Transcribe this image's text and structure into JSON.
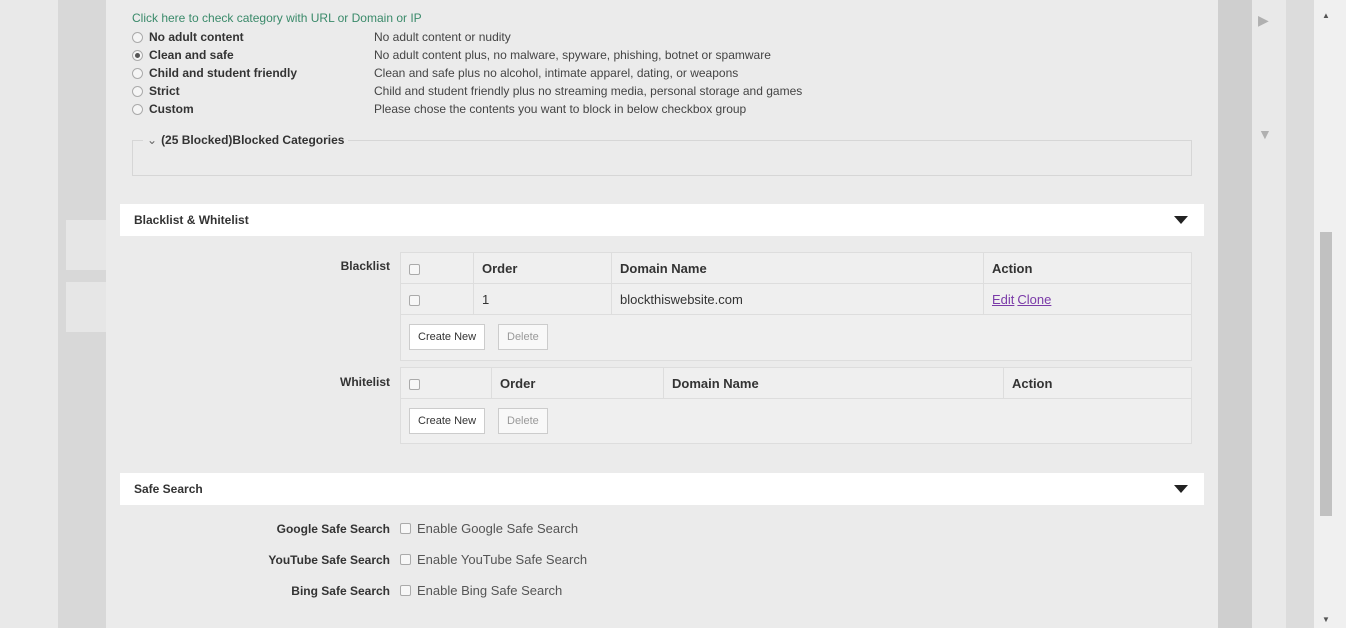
{
  "category": {
    "check_link": "Click here to check category with URL or Domain or IP",
    "options": [
      {
        "label": "No adult content",
        "desc": "No adult content or nudity",
        "checked": false
      },
      {
        "label": "Clean and safe",
        "desc": "No adult content plus, no malware, spyware, phishing, botnet or spamware",
        "checked": true
      },
      {
        "label": "Child and student friendly",
        "desc": "Clean and safe plus no alcohol, intimate apparel, dating, or weapons",
        "checked": false
      },
      {
        "label": "Strict",
        "desc": "Child and student friendly plus no streaming media, personal storage and games",
        "checked": false
      },
      {
        "label": "Custom",
        "desc": "Please chose the contents you want to block in below checkbox group",
        "checked": false
      }
    ],
    "blocked_legend": "(25 Blocked)Blocked Categories",
    "chevron": "⌄"
  },
  "blacklist_section": {
    "title": "Blacklist & Whitelist",
    "blacklist": {
      "label": "Blacklist",
      "headers": {
        "order": "Order",
        "domain": "Domain Name",
        "action": "Action"
      },
      "rows": [
        {
          "order": "1",
          "domain": "blockthiswebsite.com",
          "edit": "Edit",
          "clone": "Clone"
        }
      ],
      "create_new": "Create New",
      "delete": "Delete"
    },
    "whitelist": {
      "label": "Whitelist",
      "headers": {
        "order": "Order",
        "domain": "Domain Name",
        "action": "Action"
      },
      "create_new": "Create New",
      "delete": "Delete"
    }
  },
  "safe_search": {
    "title": "Safe Search",
    "items": [
      {
        "label": "Google Safe Search",
        "option": "Enable Google Safe Search"
      },
      {
        "label": "YouTube Safe Search",
        "option": "Enable YouTube Safe Search"
      },
      {
        "label": "Bing Safe Search",
        "option": "Enable Bing Safe Search"
      }
    ]
  },
  "colors": {
    "link_green": "#3a8a6a",
    "link_purple": "#7a3aa8",
    "panel_bg": "#ebebeb",
    "header_bg": "#ffffff"
  },
  "icons": [
    "radio-icon",
    "checkbox-icon",
    "caret-down-icon",
    "chevron-down-icon",
    "scroll-up-icon",
    "scroll-down-icon"
  ]
}
